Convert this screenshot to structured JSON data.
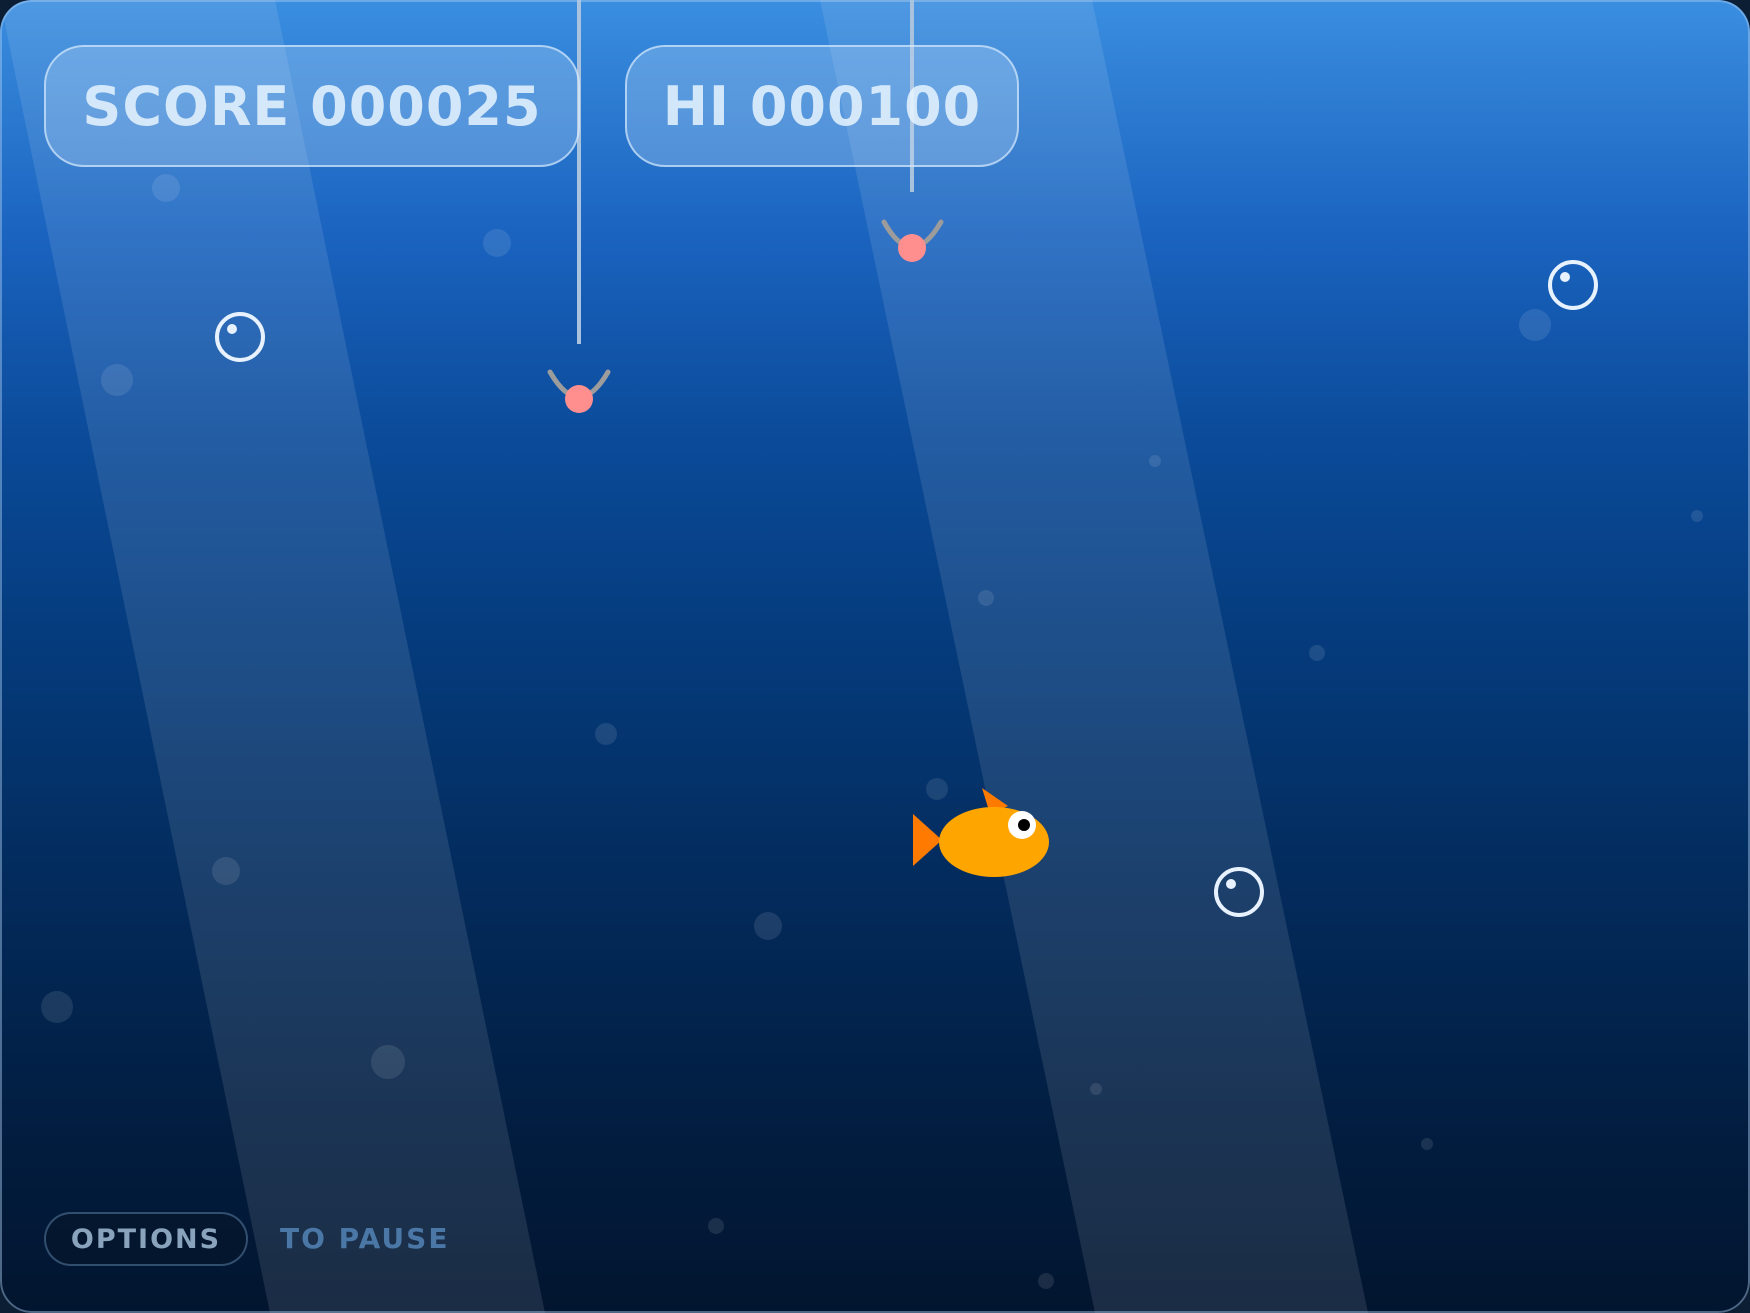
{
  "hud": {
    "score_text": "SCORE 000025",
    "hi_text": "HI 000100"
  },
  "controls": {
    "options_label": "OPTIONS",
    "pause_hint": "TO PAUSE"
  },
  "colors": {
    "fish_body": "#ffa500",
    "fish_fin": "#ff7a00",
    "bait": "#ff8f8f",
    "hook": "#9c9c9c",
    "line": "#a9c2dd",
    "bubble_outline": "#e8f2ff"
  },
  "icons": {
    "player": "fish-icon",
    "hazard": "fishing-hook-icon",
    "collectible": "bubble-icon"
  }
}
